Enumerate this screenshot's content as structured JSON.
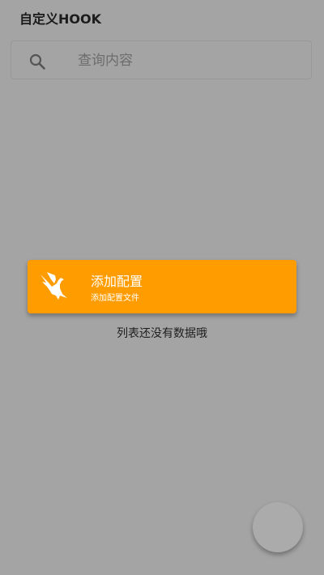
{
  "header": {
    "title": "自定义HOOK"
  },
  "search": {
    "placeholder": "查询内容",
    "icon": "search-icon"
  },
  "add_config_card": {
    "title": "添加配置",
    "subtitle": "添加配置文件",
    "icon": "eagle-icon",
    "background_color": "#ff9c00"
  },
  "list": {
    "empty_message": "列表还没有数据哦"
  },
  "fab": {
    "color": "#ababab"
  },
  "theme": {
    "page_background": "#a4a4a4"
  }
}
